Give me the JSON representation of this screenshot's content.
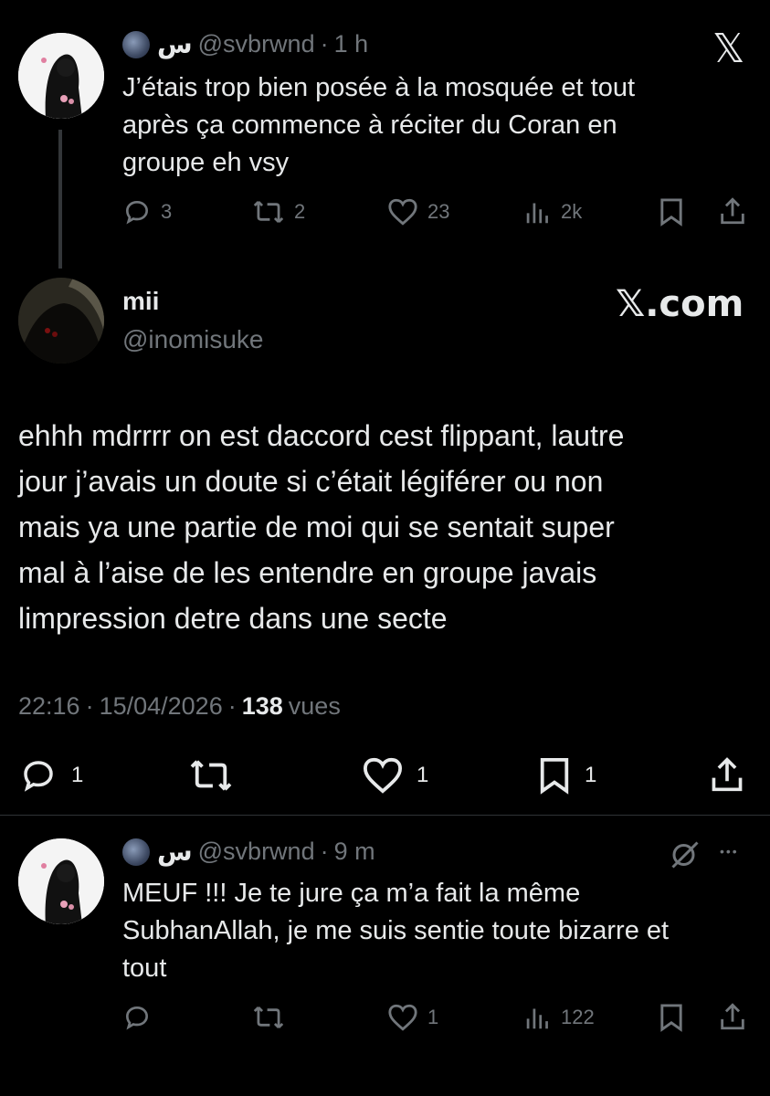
{
  "tweet1": {
    "name": "س",
    "handle": "@svbrwnd",
    "time": "1 h",
    "text_lines": [
      "J’étais trop bien posée à la mosquée et tout",
      "après ça commence à réciter du Coran en",
      "groupe eh vsy"
    ],
    "replies": "3",
    "retweets": "2",
    "likes": "23",
    "views": "2k"
  },
  "x_logo_glyph": "𝕏",
  "main_tweet": {
    "name": "mii",
    "handle": "@inomisuke",
    "watermark": "𝕏.com",
    "text_lines": [
      "ehhh mdrrrr on est daccord cest flippant, lautre",
      "jour j’avais un doute si c’était légiférer ou non",
      "mais ya une partie de moi qui se sentait super",
      "mal à l’aise de les entendre en groupe javais",
      "limpression detre dans une secte"
    ],
    "time": "22:16",
    "date": "15/04/2026",
    "views_count": "138",
    "views_label": "vues",
    "replies": "1",
    "likes": "1",
    "bookmarks": "1"
  },
  "tweet3": {
    "name": "س",
    "handle": "@svbrwnd",
    "time": "9 m",
    "text_lines": [
      "MEUF !!! Je te jure ça m’a fait la même",
      "SubhanAllah, je me suis sentie toute bizarre et",
      "tout"
    ],
    "likes": "1",
    "views": "122",
    "more_glyph": "•••"
  },
  "separator_dot": "·",
  "colors": {
    "background": "#000000",
    "text": "#e7e9ea",
    "muted": "#71767b",
    "divider": "#2f3336"
  }
}
